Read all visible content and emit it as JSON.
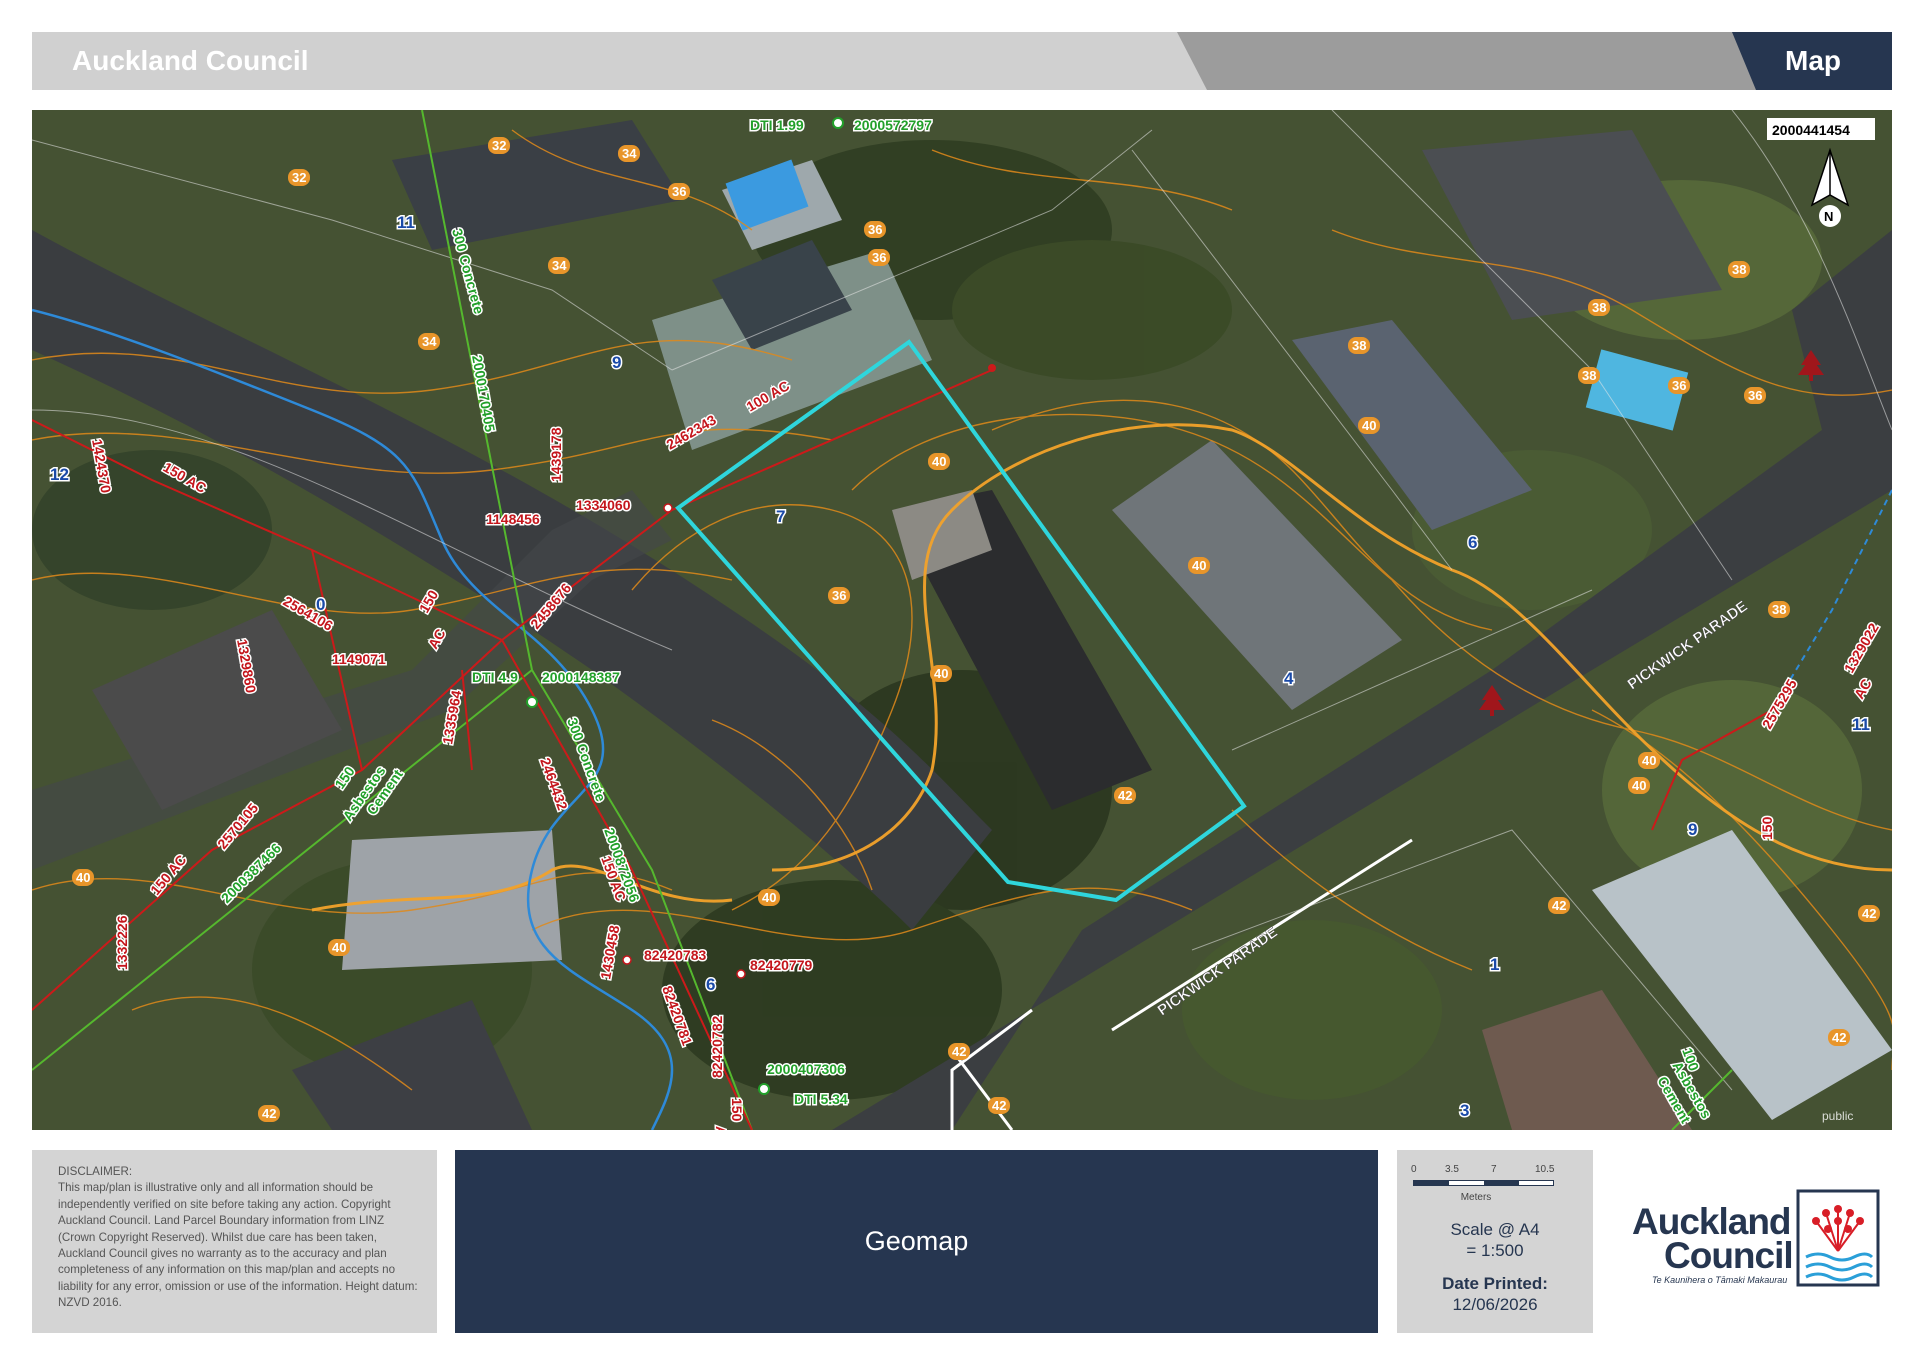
{
  "header": {
    "title": "Auckland Council",
    "right_label": "Map"
  },
  "map": {
    "north_label": "N",
    "corner_label": "2000441454",
    "parcel_outline_color": "#2fd6dc",
    "watermark": "public",
    "streets": [
      "PICKWICK PARADE",
      "PICKWICK PARADE"
    ],
    "house_numbers": [
      "11",
      "9",
      "7",
      "12",
      "6",
      "4",
      "0",
      "11",
      "9",
      "1",
      "3",
      "6"
    ],
    "contours": [
      "32",
      "32",
      "34",
      "34",
      "36",
      "36",
      "34",
      "36",
      "38",
      "38",
      "38",
      "36",
      "40",
      "40",
      "40",
      "38",
      "38",
      "40",
      "40",
      "42",
      "42",
      "42",
      "40",
      "40",
      "42",
      "42",
      "40",
      "42",
      "42",
      "40",
      "36",
      "36"
    ],
    "red_labels": [
      "1424370",
      "150 AC",
      "1329860",
      "2564106",
      "1149071",
      "150",
      "AC",
      "2458676",
      "1148456",
      "1334060",
      "1439178",
      "2462343",
      "100 AC",
      "1335964",
      "2464432",
      "150 AC",
      "150 AC",
      "2570105",
      "1332226",
      "1430458",
      "82420783",
      "82420779",
      "82420781",
      "82420782",
      "150",
      "AC",
      "2575295",
      "1329022",
      "150",
      "AC"
    ],
    "green_labels": [
      "DTI 1.99",
      "2000572797",
      "300 Concrete",
      "2000170405",
      "DTI 4.9",
      "2000148387",
      "300 Concrete",
      "2000872056",
      "150",
      "Asbestos",
      "Cement",
      "2000387466",
      "2000407306",
      "DTI 5.34",
      "100",
      "Asbestos",
      "Cement"
    ]
  },
  "footer": {
    "disclaimer_title": "DISCLAIMER:",
    "disclaimer_text": "This map/plan is illustrative only and all information should be independently verified on site before taking any action. Copyright Auckland Council.  Land Parcel Boundary information from LINZ (Crown Copyright Reserved). Whilst due care has been taken, Auckland Council gives no warranty as to the accuracy and plan completeness of any information on this map/plan and accepts no liability for any error, omission or use of the information. Height datum: NZVD 2016.",
    "geomap_label": "Geomap",
    "scale_ticks": [
      "0",
      "3.5",
      "7",
      "10.5"
    ],
    "scale_units": "Meters",
    "scale_label": "Scale @ A4",
    "scale_value": "= 1:500",
    "date_label": "Date Printed:",
    "date_value": "12/06/2026",
    "logo_line1": "Auckland",
    "logo_line2": "Council",
    "logo_tagline": "Te Kaunihera o Tāmaki Makaurau"
  },
  "colors": {
    "navy": "#263650",
    "water_line": "#2e8ad8",
    "sewer_line": "#cc1a1a",
    "storm_line": "#55b82e",
    "contour": "#e08a1a"
  }
}
